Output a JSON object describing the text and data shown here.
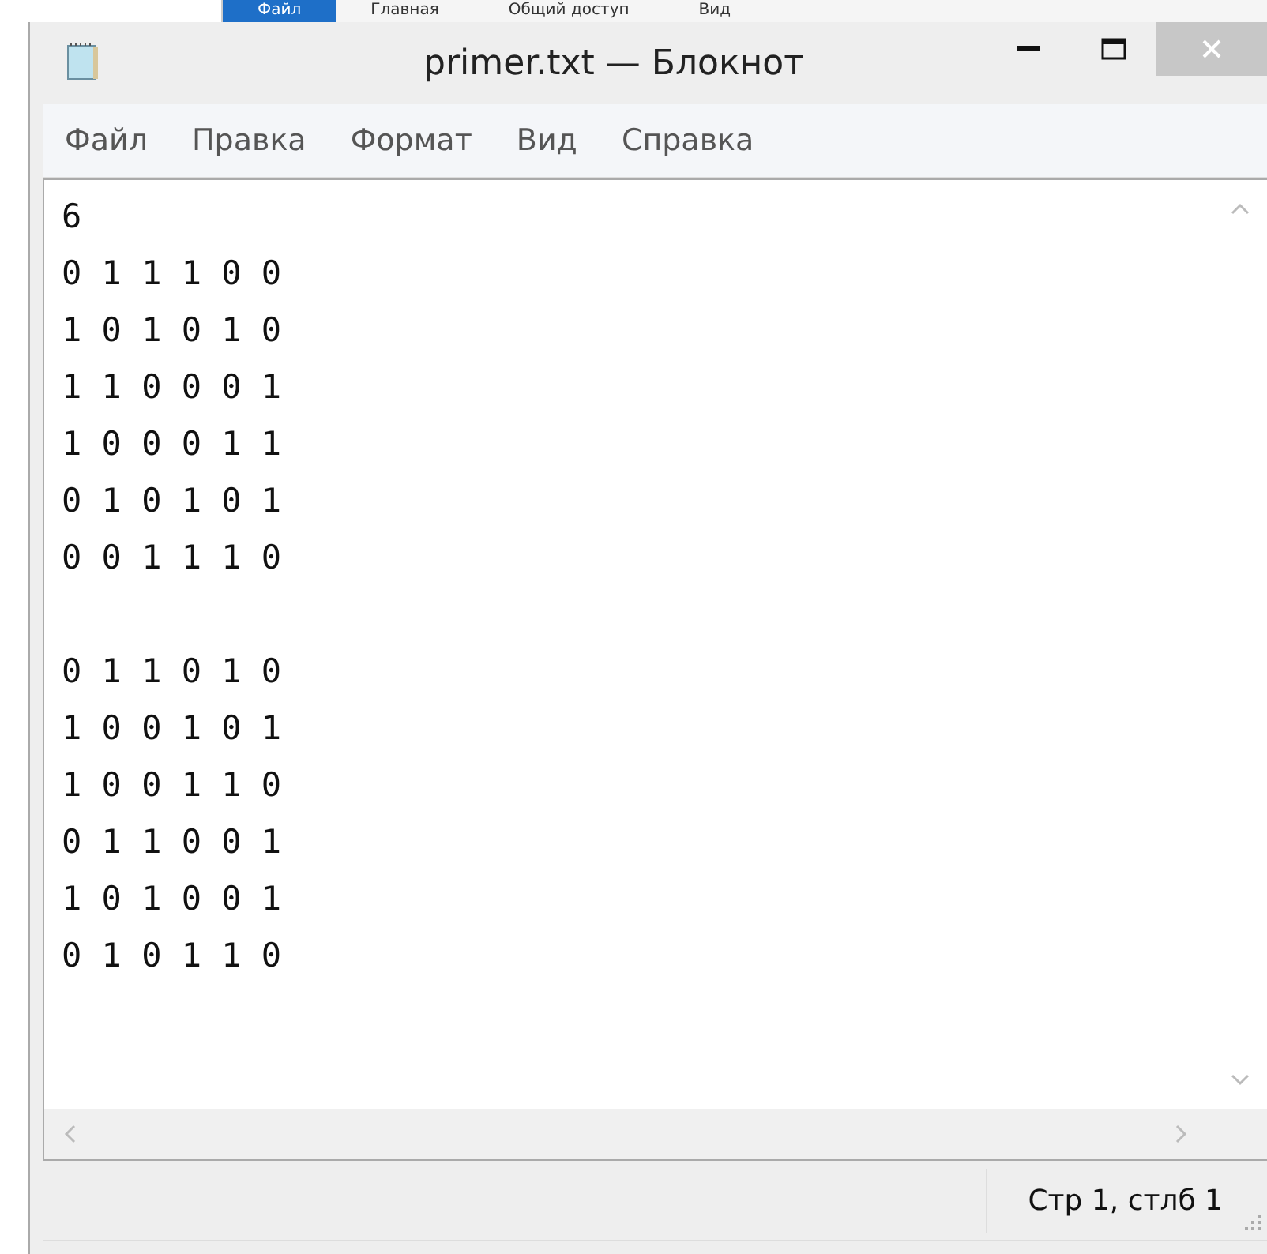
{
  "background_ribbon": {
    "tabs": [
      {
        "label": "Файл",
        "selected": true
      },
      {
        "label": "Главная",
        "selected": false
      },
      {
        "label": "Общий доступ",
        "selected": false
      },
      {
        "label": "Вид",
        "selected": false
      }
    ]
  },
  "window": {
    "title": "primer.txt — Блокнот"
  },
  "menu": [
    "Файл",
    "Правка",
    "Формат",
    "Вид",
    "Справка"
  ],
  "editor": {
    "content": "6\n0 1 1 1 0 0\n1 0 1 0 1 0\n1 1 0 0 0 1\n1 0 0 0 1 1\n0 1 0 1 0 1\n0 0 1 1 1 0\n\n0 1 1 0 1 0\n1 0 0 1 0 1\n1 0 0 1 1 0\n0 1 1 0 0 1\n1 0 1 0 0 1\n0 1 0 1 1 0"
  },
  "status_bar": {
    "position": "Стр 1, стлб 1"
  }
}
